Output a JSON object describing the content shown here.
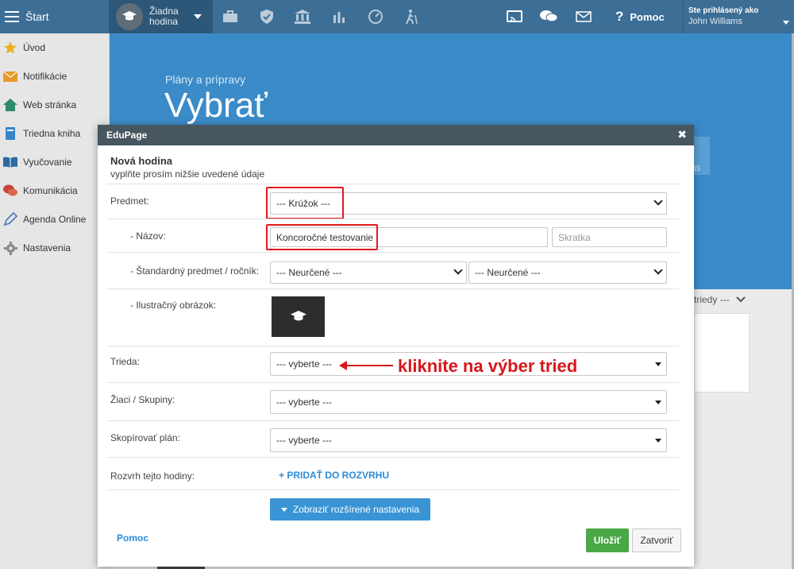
{
  "topbar": {
    "start_label": "Štart",
    "lesson_label": "Žiadna hodina",
    "help_label": "Pomoc",
    "user_caption": "Ste prihlásený ako",
    "user_name": "John Williams"
  },
  "sidebar": {
    "items": [
      {
        "label": "Úvod",
        "icon": "star-icon"
      },
      {
        "label": "Notifikácie",
        "icon": "envelope-icon"
      },
      {
        "label": "Web stránka",
        "icon": "home-icon"
      },
      {
        "label": "Triedna kniha",
        "icon": "book-icon"
      },
      {
        "label": "Vyučovanie",
        "icon": "open-book-icon"
      },
      {
        "label": "Komunikácia",
        "icon": "chat-icon"
      },
      {
        "label": "Agenda Online",
        "icon": "pen-icon"
      },
      {
        "label": "Nastavenia",
        "icon": "gear-icon"
      }
    ]
  },
  "main": {
    "breadcrumb": "Plány a prípravy",
    "title": "Vybrať",
    "behind_number": "45",
    "trieda_peek": "triedy ---"
  },
  "modal": {
    "header": "EduPage",
    "title": "Nová hodina",
    "subtitle": "vyplňte prosím nižšie uvedené údaje",
    "fields": {
      "predmet_label": "Predmet:",
      "predmet_value": "--- Krúžok ---",
      "nazov_label": "- Názov:",
      "nazov_value": "Koncoročné testovanie",
      "skratka_placeholder": "Skratka",
      "standard_label": "- Štandardný predmet / ročník:",
      "standard_value1": "--- Neurčené ---",
      "standard_value2": "--- Neurčené ---",
      "obrazok_label": "- Ilustračný obrázok:",
      "trieda_label": "Trieda:",
      "trieda_value": "--- vyberte ---",
      "ziaci_label": "Žiaci / Skupiny:",
      "ziaci_value": "--- vyberte ---",
      "kopirovat_label": "Skopírovať plán:",
      "kopirovat_value": "--- vyberte ---",
      "rozvrh_label": "Rozvrh tejto hodiny:",
      "rozvrh_link": "+ PRIDAŤ DO ROZVRHU"
    },
    "advanced_button": "Zobraziť rozšírené nastavenia",
    "help_link": "Pomoc",
    "save_button": "Uložiť",
    "close_button": "Zatvoriť"
  },
  "annotation": {
    "text": "kliknite na výber tried"
  },
  "colors": {
    "topbar": "#3c6e96",
    "main_blue": "#3b8bc9",
    "modal_header": "#47565f",
    "save_green": "#4aa846",
    "link_blue": "#2d8ad4",
    "annotation_red": "#d8161b"
  }
}
